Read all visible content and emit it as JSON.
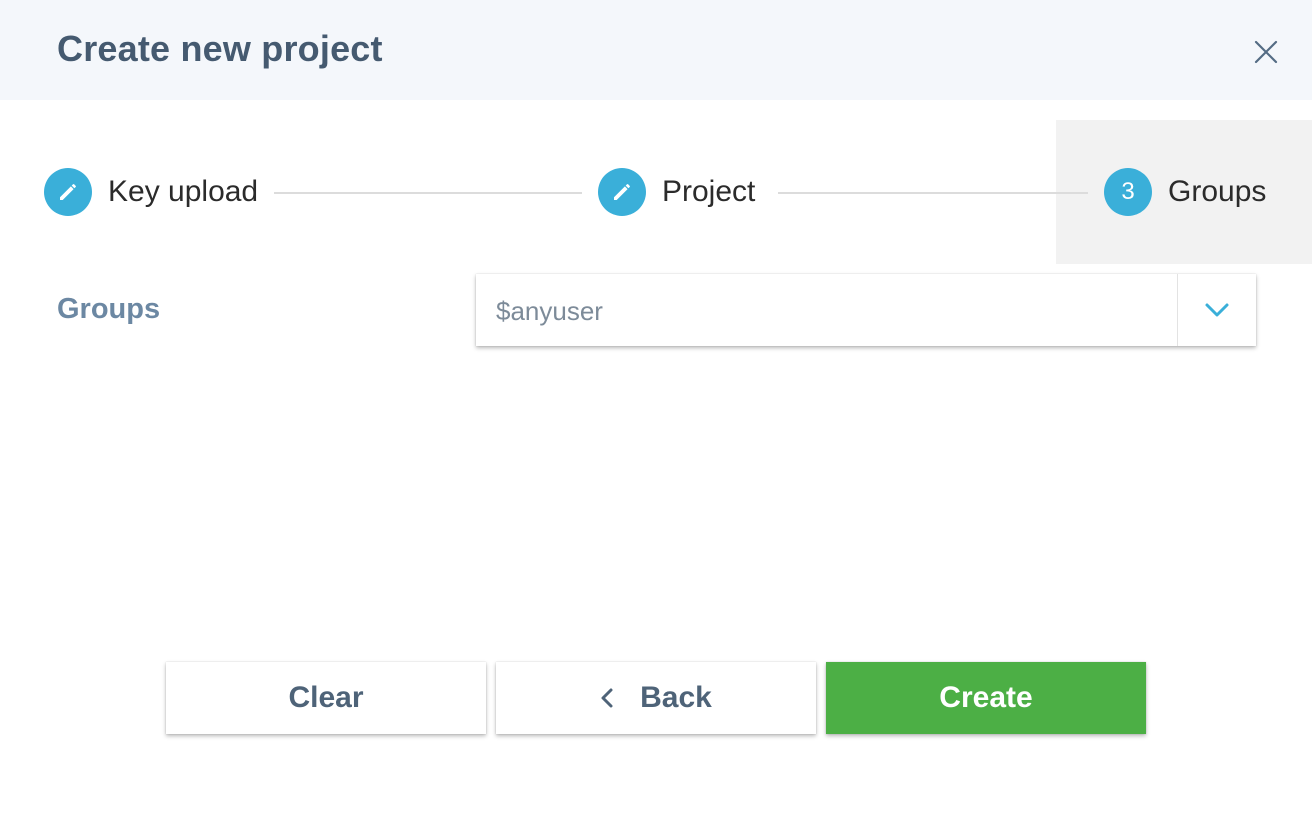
{
  "dialog": {
    "title": "Create new project",
    "close_icon": "close-icon"
  },
  "stepper": {
    "steps": [
      {
        "label": "Key upload",
        "icon": "pencil-icon",
        "state": "completed"
      },
      {
        "label": "Project",
        "icon": "pencil-icon",
        "state": "completed"
      },
      {
        "label": "Groups",
        "number": "3",
        "state": "active"
      }
    ],
    "accent_color": "#3aafd9"
  },
  "groups_field": {
    "label": "Groups",
    "value": "$anyuser",
    "dropdown_icon": "chevron-down-icon"
  },
  "actions": {
    "clear_label": "Clear",
    "back_label": "Back",
    "back_icon": "chevron-left-icon",
    "create_label": "Create",
    "create_color": "#4caf45"
  }
}
